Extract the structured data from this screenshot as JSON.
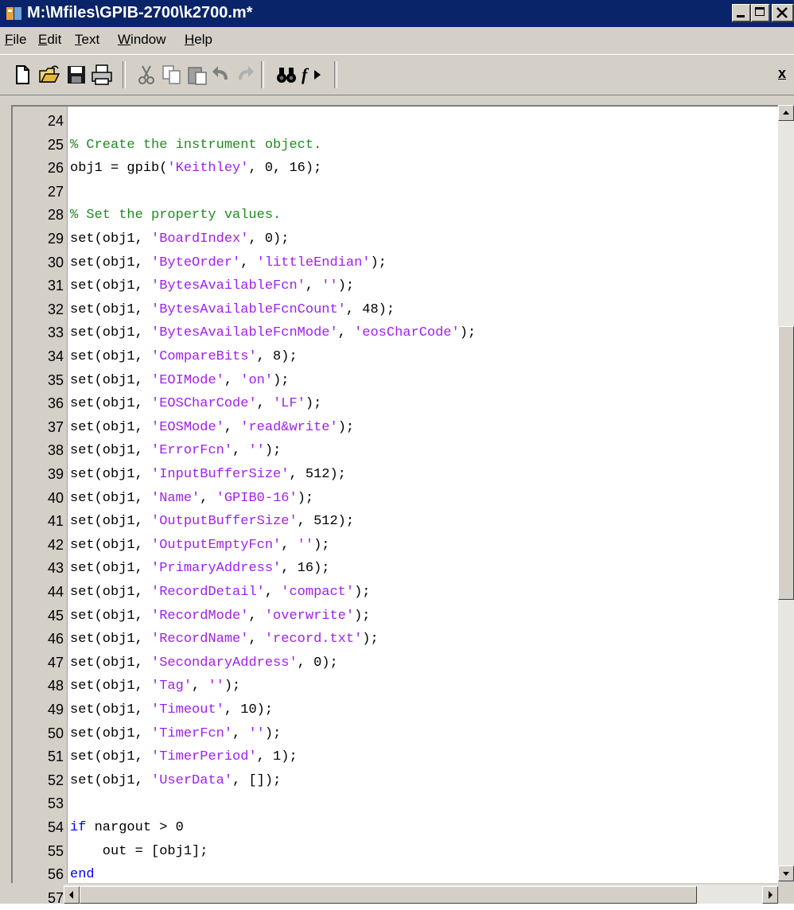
{
  "window": {
    "title": "M:\\Mfiles\\GPIB-2700\\k2700.m*"
  },
  "menu": [
    {
      "label": "File",
      "ul": "F",
      "rest": "ile"
    },
    {
      "label": "Edit",
      "ul": "E",
      "rest": "dit"
    },
    {
      "label": "Text",
      "ul": "T",
      "rest": "ext"
    },
    {
      "label": "Window",
      "ul": "W",
      "rest": "indow"
    },
    {
      "label": "Help",
      "ul": "H",
      "rest": "elp"
    }
  ],
  "toolbar": {
    "icons": [
      "new-file-icon",
      "open-folder-icon",
      "save-icon",
      "print-icon",
      "cut-icon",
      "copy-icon",
      "paste-icon",
      "undo-icon",
      "redo-icon",
      "find-icon",
      "function-icon"
    ],
    "close_label": "x"
  },
  "editor": {
    "lines": [
      {
        "n": "24",
        "parts": []
      },
      {
        "n": "25",
        "parts": [
          {
            "t": "% Create the instrument object.",
            "c": "cm"
          }
        ]
      },
      {
        "n": "26",
        "parts": [
          {
            "t": "obj1 = gpib(",
            "c": ""
          },
          {
            "t": "'Keithley'",
            "c": "str"
          },
          {
            "t": ", 0, 16);",
            "c": ""
          }
        ]
      },
      {
        "n": "27",
        "parts": []
      },
      {
        "n": "28",
        "parts": [
          {
            "t": "% Set the property values.",
            "c": "cm"
          }
        ]
      },
      {
        "n": "29",
        "parts": [
          {
            "t": "set(obj1, ",
            "c": ""
          },
          {
            "t": "'BoardIndex'",
            "c": "str"
          },
          {
            "t": ", 0);",
            "c": ""
          }
        ]
      },
      {
        "n": "30",
        "parts": [
          {
            "t": "set(obj1, ",
            "c": ""
          },
          {
            "t": "'ByteOrder'",
            "c": "str"
          },
          {
            "t": ", ",
            "c": ""
          },
          {
            "t": "'littleEndian'",
            "c": "str"
          },
          {
            "t": ");",
            "c": ""
          }
        ]
      },
      {
        "n": "31",
        "parts": [
          {
            "t": "set(obj1, ",
            "c": ""
          },
          {
            "t": "'BytesAvailableFcn'",
            "c": "str"
          },
          {
            "t": ", ",
            "c": ""
          },
          {
            "t": "''",
            "c": "str"
          },
          {
            "t": ");",
            "c": ""
          }
        ]
      },
      {
        "n": "32",
        "parts": [
          {
            "t": "set(obj1, ",
            "c": ""
          },
          {
            "t": "'BytesAvailableFcnCount'",
            "c": "str"
          },
          {
            "t": ", 48);",
            "c": ""
          }
        ]
      },
      {
        "n": "33",
        "parts": [
          {
            "t": "set(obj1, ",
            "c": ""
          },
          {
            "t": "'BytesAvailableFcnMode'",
            "c": "str"
          },
          {
            "t": ", ",
            "c": ""
          },
          {
            "t": "'eosCharCode'",
            "c": "str"
          },
          {
            "t": ");",
            "c": ""
          }
        ]
      },
      {
        "n": "34",
        "parts": [
          {
            "t": "set(obj1, ",
            "c": ""
          },
          {
            "t": "'CompareBits'",
            "c": "str"
          },
          {
            "t": ", 8);",
            "c": ""
          }
        ]
      },
      {
        "n": "35",
        "parts": [
          {
            "t": "set(obj1, ",
            "c": ""
          },
          {
            "t": "'EOIMode'",
            "c": "str"
          },
          {
            "t": ", ",
            "c": ""
          },
          {
            "t": "'on'",
            "c": "str"
          },
          {
            "t": ");",
            "c": ""
          }
        ]
      },
      {
        "n": "36",
        "parts": [
          {
            "t": "set(obj1, ",
            "c": ""
          },
          {
            "t": "'EOSCharCode'",
            "c": "str"
          },
          {
            "t": ", ",
            "c": ""
          },
          {
            "t": "'LF'",
            "c": "str"
          },
          {
            "t": ");",
            "c": ""
          }
        ]
      },
      {
        "n": "37",
        "parts": [
          {
            "t": "set(obj1, ",
            "c": ""
          },
          {
            "t": "'EOSMode'",
            "c": "str"
          },
          {
            "t": ", ",
            "c": ""
          },
          {
            "t": "'read&write'",
            "c": "str"
          },
          {
            "t": ");",
            "c": ""
          }
        ]
      },
      {
        "n": "38",
        "parts": [
          {
            "t": "set(obj1, ",
            "c": ""
          },
          {
            "t": "'ErrorFcn'",
            "c": "str"
          },
          {
            "t": ", ",
            "c": ""
          },
          {
            "t": "''",
            "c": "str"
          },
          {
            "t": ");",
            "c": ""
          }
        ]
      },
      {
        "n": "39",
        "parts": [
          {
            "t": "set(obj1, ",
            "c": ""
          },
          {
            "t": "'InputBufferSize'",
            "c": "str"
          },
          {
            "t": ", 512);",
            "c": ""
          }
        ]
      },
      {
        "n": "40",
        "parts": [
          {
            "t": "set(obj1, ",
            "c": ""
          },
          {
            "t": "'Name'",
            "c": "str"
          },
          {
            "t": ", ",
            "c": ""
          },
          {
            "t": "'GPIB0-16'",
            "c": "str"
          },
          {
            "t": ");",
            "c": ""
          }
        ]
      },
      {
        "n": "41",
        "parts": [
          {
            "t": "set(obj1, ",
            "c": ""
          },
          {
            "t": "'OutputBufferSize'",
            "c": "str"
          },
          {
            "t": ", 512);",
            "c": ""
          }
        ]
      },
      {
        "n": "42",
        "parts": [
          {
            "t": "set(obj1, ",
            "c": ""
          },
          {
            "t": "'OutputEmptyFcn'",
            "c": "str"
          },
          {
            "t": ", ",
            "c": ""
          },
          {
            "t": "''",
            "c": "str"
          },
          {
            "t": ");",
            "c": ""
          }
        ]
      },
      {
        "n": "43",
        "parts": [
          {
            "t": "set(obj1, ",
            "c": ""
          },
          {
            "t": "'PrimaryAddress'",
            "c": "str"
          },
          {
            "t": ", 16);",
            "c": ""
          }
        ]
      },
      {
        "n": "44",
        "parts": [
          {
            "t": "set(obj1, ",
            "c": ""
          },
          {
            "t": "'RecordDetail'",
            "c": "str"
          },
          {
            "t": ", ",
            "c": ""
          },
          {
            "t": "'compact'",
            "c": "str"
          },
          {
            "t": ");",
            "c": ""
          }
        ]
      },
      {
        "n": "45",
        "parts": [
          {
            "t": "set(obj1, ",
            "c": ""
          },
          {
            "t": "'RecordMode'",
            "c": "str"
          },
          {
            "t": ", ",
            "c": ""
          },
          {
            "t": "'overwrite'",
            "c": "str"
          },
          {
            "t": ");",
            "c": ""
          }
        ]
      },
      {
        "n": "46",
        "parts": [
          {
            "t": "set(obj1, ",
            "c": ""
          },
          {
            "t": "'RecordName'",
            "c": "str"
          },
          {
            "t": ", ",
            "c": ""
          },
          {
            "t": "'record.txt'",
            "c": "str"
          },
          {
            "t": ");",
            "c": ""
          }
        ]
      },
      {
        "n": "47",
        "parts": [
          {
            "t": "set(obj1, ",
            "c": ""
          },
          {
            "t": "'SecondaryAddress'",
            "c": "str"
          },
          {
            "t": ", 0);",
            "c": ""
          }
        ]
      },
      {
        "n": "48",
        "parts": [
          {
            "t": "set(obj1, ",
            "c": ""
          },
          {
            "t": "'Tag'",
            "c": "str"
          },
          {
            "t": ", ",
            "c": ""
          },
          {
            "t": "''",
            "c": "str"
          },
          {
            "t": ");",
            "c": ""
          }
        ]
      },
      {
        "n": "49",
        "parts": [
          {
            "t": "set(obj1, ",
            "c": ""
          },
          {
            "t": "'Timeout'",
            "c": "str"
          },
          {
            "t": ", 10);",
            "c": ""
          }
        ]
      },
      {
        "n": "50",
        "parts": [
          {
            "t": "set(obj1, ",
            "c": ""
          },
          {
            "t": "'TimerFcn'",
            "c": "str"
          },
          {
            "t": ", ",
            "c": ""
          },
          {
            "t": "''",
            "c": "str"
          },
          {
            "t": ");",
            "c": ""
          }
        ]
      },
      {
        "n": "51",
        "parts": [
          {
            "t": "set(obj1, ",
            "c": ""
          },
          {
            "t": "'TimerPeriod'",
            "c": "str"
          },
          {
            "t": ", 1);",
            "c": ""
          }
        ]
      },
      {
        "n": "52",
        "parts": [
          {
            "t": "set(obj1, ",
            "c": ""
          },
          {
            "t": "'UserData'",
            "c": "str"
          },
          {
            "t": ", []);",
            "c": ""
          }
        ]
      },
      {
        "n": "53",
        "parts": []
      },
      {
        "n": "54",
        "parts": [
          {
            "t": "if",
            "c": "kw"
          },
          {
            "t": " nargout > 0",
            "c": ""
          }
        ]
      },
      {
        "n": "55",
        "parts": [
          {
            "t": "    out = [obj1];",
            "c": ""
          }
        ]
      },
      {
        "n": "56",
        "parts": [
          {
            "t": "end",
            "c": "kw"
          }
        ]
      },
      {
        "n": "57",
        "parts": []
      }
    ]
  },
  "colors": {
    "titlebar": "#0a246a",
    "keyword": "#0000ff",
    "comment": "#228b22",
    "string": "#a020f0"
  }
}
